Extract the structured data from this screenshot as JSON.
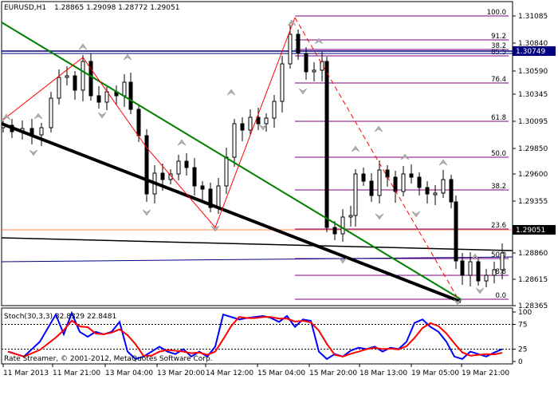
{
  "symbol_label": "EURUSD,H1",
  "ohlc_label": "1.28865 1.29098 1.28772 1.29051",
  "current_price": "1.29051",
  "level_price": "1.30749",
  "price_ticks": [
    "1.31085",
    "1.30840",
    "1.30590",
    "1.30345",
    "1.30095",
    "1.29850",
    "1.29600",
    "1.29355",
    "1.29105",
    "1.28860",
    "1.28615",
    "1.28365"
  ],
  "time_ticks": [
    "11 Mar 2013",
    "11 Mar 21:00",
    "13 Mar 04:00",
    "13 Mar 20:00",
    "14 Mar 12:00",
    "15 Mar 04:00",
    "15 Mar 20:00",
    "18 Mar 13:00",
    "19 Mar 05:00",
    "19 Mar 21:00"
  ],
  "fib_upper": [
    "100.0",
    "91.2",
    "38.2",
    "85.5",
    "76.4",
    "61.8",
    "50.0",
    "38.2",
    "23.6"
  ],
  "fib_lower": [
    "50.0",
    "8.8",
    "0.0"
  ],
  "indicator": {
    "label": "Stoch(30,3,3) 32.8329 22.8481",
    "ticks": [
      "100",
      "75",
      "25",
      "0"
    ]
  },
  "copyright": "Rate Streamer, © 2001-2012, MetaQuotes Software Corp.",
  "colors": {
    "background": "#ffffff",
    "candle": "#000000",
    "fib_lines": "#800080",
    "trend_green": "#008000",
    "trend_black": "#000000",
    "zigzag_red": "#ff0000",
    "price_label_bg": "#000080",
    "stoch_main": "#0000ff",
    "stoch_signal": "#ff0000",
    "hline_orange": "#ff8040",
    "hline_blue": "#000080"
  },
  "icons": [
    "fractal-up-arrow-icon",
    "fractal-down-arrow-icon"
  ]
}
